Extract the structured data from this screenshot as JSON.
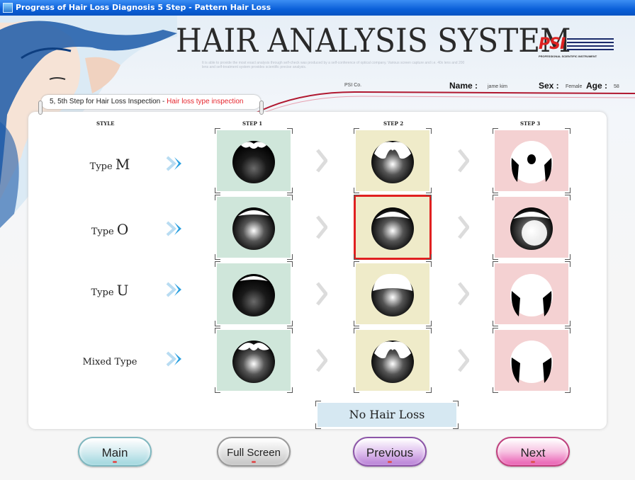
{
  "window": {
    "title": "Progress of Hair Loss Diagnosis 5 Step - Pattern Hair Loss"
  },
  "header": {
    "title": "HAIR ANALYSIS SYSTEM",
    "caption": "It is able to provide the most exact analysis through self-check was produced by a self-conference of optical company. Various screen capture and i.e. 40x lens and 200 lens and self-treatment system provides scientific precise analysis.",
    "logo": {
      "mark": "PSI",
      "tagline": "PROFESSIONAL SCIENTIFIC INSTRUMENT"
    },
    "company": "PSI Co.",
    "name_label": "Name :",
    "name_value": "jame kim",
    "sex_label": "Sex :",
    "sex_value": "Female",
    "age_label": "Age :",
    "age_value": "58"
  },
  "step": {
    "prefix": "5, 5th Step for Hair Loss Inspection - ",
    "highlight": "Hair loss type inspection"
  },
  "columns": {
    "style": "STYLE",
    "step1": "STEP 1",
    "step2": "STEP 2",
    "step3": "STEP 3"
  },
  "rows": [
    {
      "label_prefix": "Type ",
      "label_big": "M"
    },
    {
      "label_prefix": "Type ",
      "label_big": "O"
    },
    {
      "label_prefix": "Type ",
      "label_big": "U"
    },
    {
      "label_prefix": "Mixed Type",
      "label_big": ""
    }
  ],
  "selected": {
    "row": "Type O",
    "step": "STEP 2"
  },
  "no_hair_loss": "No Hair Loss",
  "buttons": {
    "main": "Main",
    "full_screen": "Full Screen",
    "previous": "Previous",
    "next": "Next"
  },
  "colors": {
    "step1_tile": "#cfe6da",
    "step2_tile": "#efebc9",
    "step3_tile": "#f4d1d2",
    "selection": "#e02020",
    "highlight_text": "#e6262e"
  }
}
